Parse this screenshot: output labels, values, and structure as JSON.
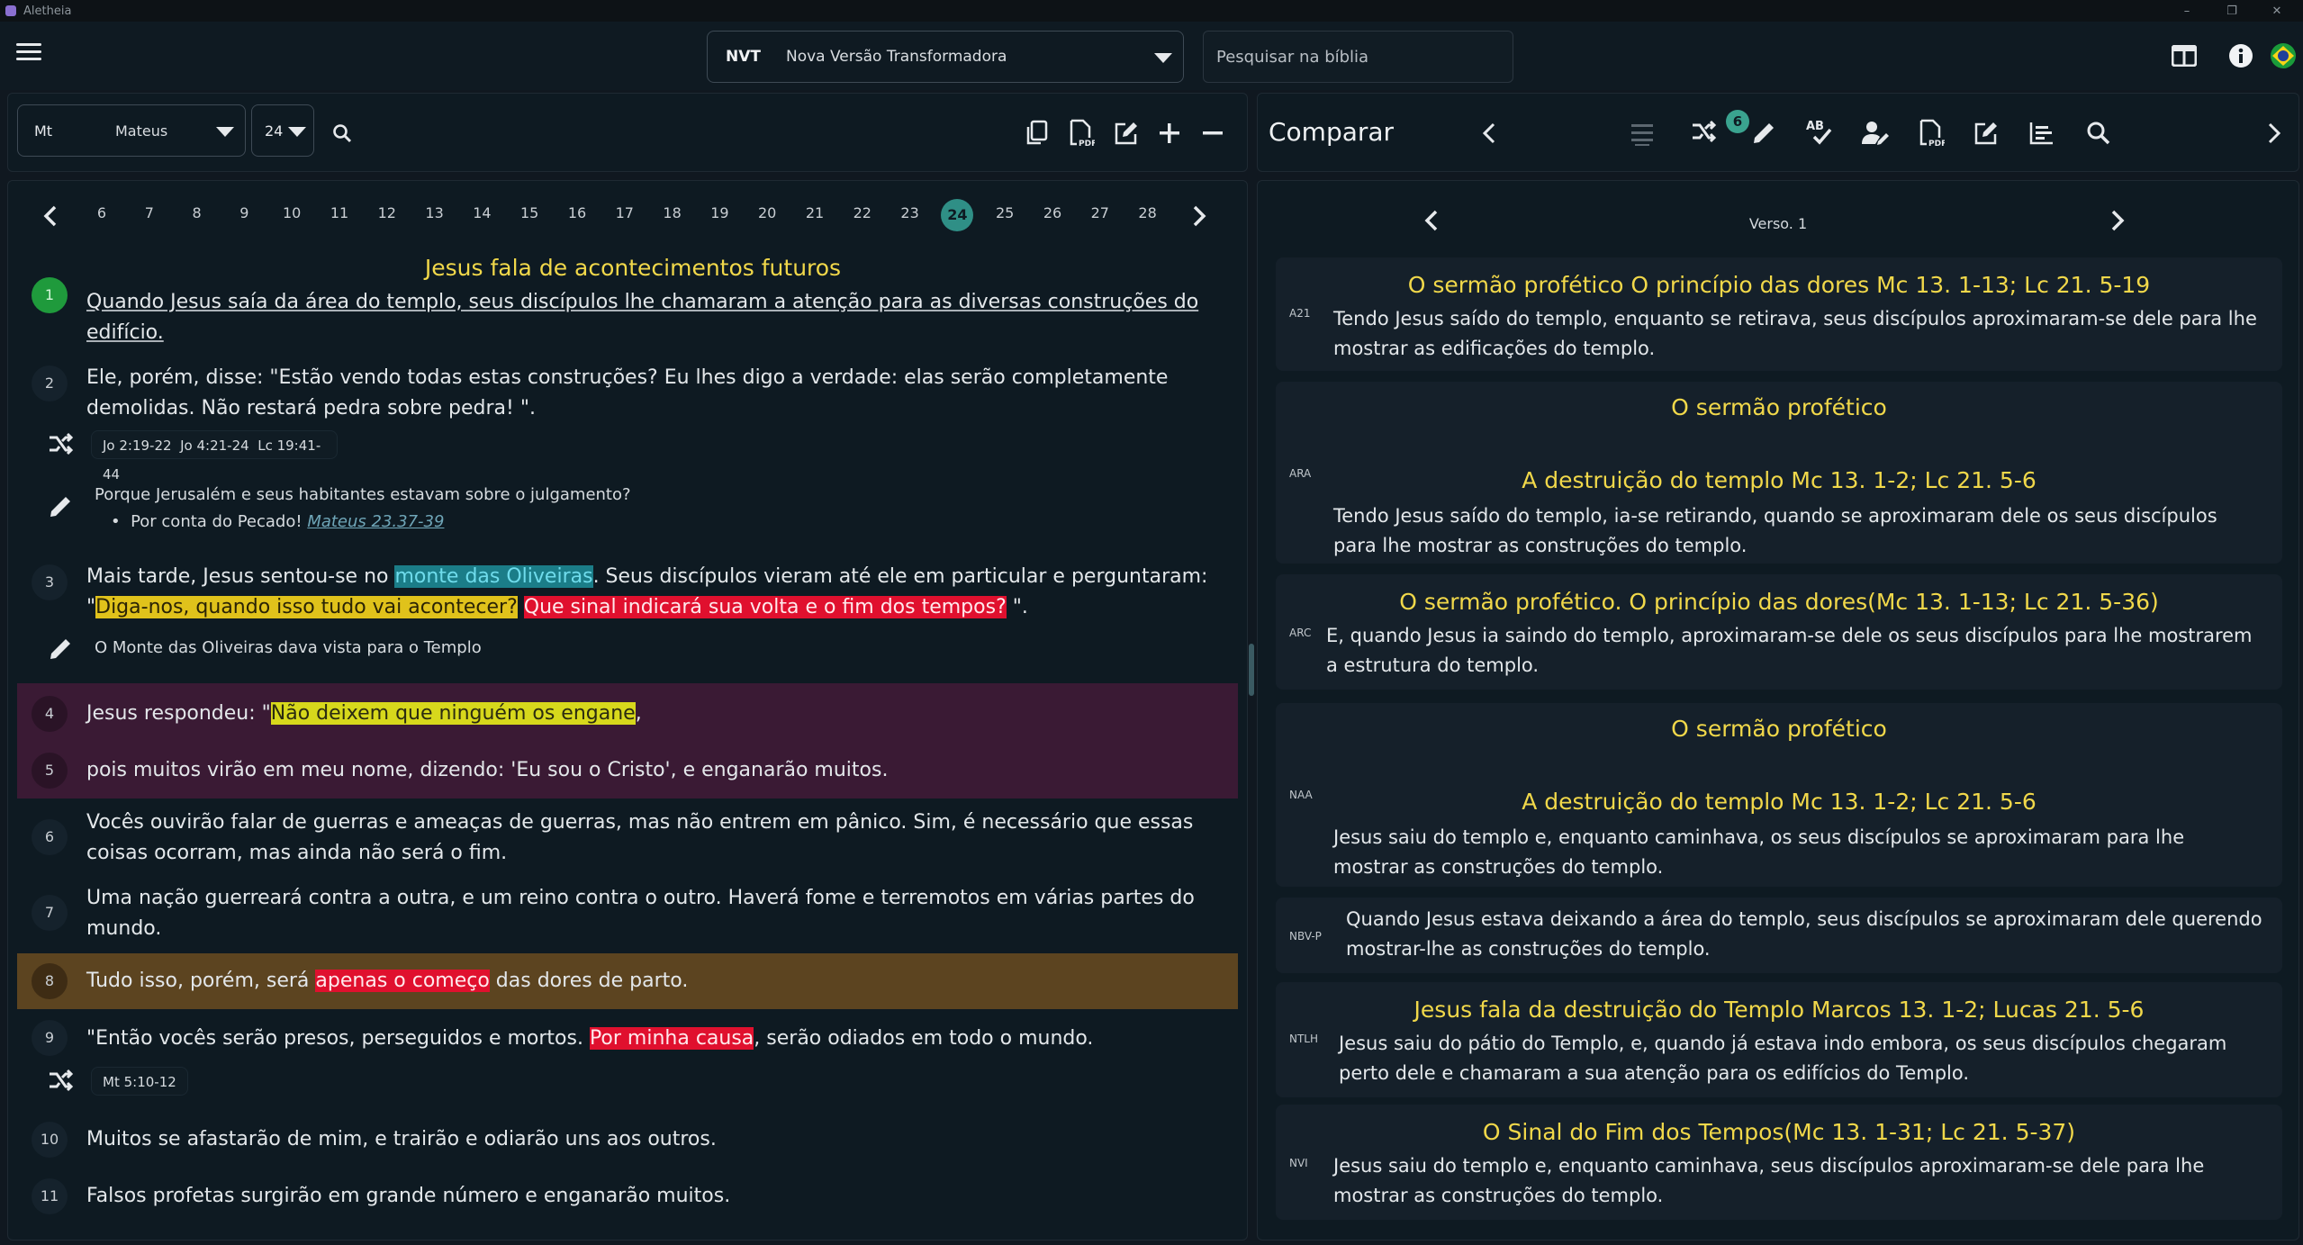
{
  "window": {
    "title": "Aletheia",
    "controls": [
      "–",
      "❐",
      "✕"
    ]
  },
  "header": {
    "version_abbr": "NVT",
    "version_name": "Nova Versão Transformadora",
    "search_placeholder": "Pesquisar na bíblia"
  },
  "reader": {
    "book_abbr": "Mt",
    "book_name": "Mateus",
    "chapter": "24",
    "chapter_nav": [
      "6",
      "7",
      "8",
      "9",
      "10",
      "11",
      "12",
      "13",
      "14",
      "15",
      "16",
      "17",
      "18",
      "19",
      "20",
      "21",
      "22",
      "23",
      "24",
      "25",
      "26",
      "27",
      "28"
    ],
    "section_title": "Jesus fala de acontecimentos futuros",
    "verses": {
      "v1": {
        "num": "1",
        "text": "Quando Jesus saía da área do templo, seus discípulos lhe chamaram a atenção para as diversas construções do edifício."
      },
      "v2": {
        "num": "2",
        "text": "Ele, porém, disse: \"Estão vendo todas estas construções? Eu lhes digo a verdade: elas serão completamente demolidas. Não restará pedra sobre pedra! \"."
      },
      "v3": {
        "num": "3",
        "t1": "Mais tarde, Jesus sentou-se no ",
        "h1": "monte das Oliveiras",
        "t2": ". Seus discípulos vieram até ele em particular e perguntaram:",
        "t3": "\"",
        "h2": "Diga-nos, quando isso tudo vai acontecer?",
        "t4": " ",
        "h3": "Que sinal indicará sua volta e o fim dos tempos?",
        "t5": " \"."
      },
      "v4": {
        "num": "4",
        "t1": "Jesus respondeu: \"",
        "h1": "Não deixem que ninguém os engane",
        "t2": ","
      },
      "v5": {
        "num": "5",
        "text": "pois muitos virão em meu nome, dizendo: 'Eu sou o Cristo', e enganarão muitos."
      },
      "v6": {
        "num": "6",
        "text": "Vocês ouvirão falar de guerras e ameaças de guerras, mas não entrem em pânico. Sim, é necessário que essas coisas ocorram, mas ainda não será o fim."
      },
      "v7": {
        "num": "7",
        "text": "Uma nação guerreará contra a outra, e um reino contra o outro. Haverá fome e terremotos em várias partes do mundo."
      },
      "v8": {
        "num": "8",
        "t1": "Tudo isso, porém, será ",
        "h1": "apenas o começo",
        "t2": " das dores de parto."
      },
      "v9": {
        "num": "9",
        "t1": "\"Então vocês serão presos, perseguidos e mortos. ",
        "h1": "Por minha causa",
        "t2": ", serão odiados em todo o mundo."
      },
      "v10": {
        "num": "10",
        "text": "Muitos se afastarão de mim, e trairão e odiarão uns aos outros."
      },
      "v11": {
        "num": "11",
        "text": "Falsos profetas surgirão em grande número e enganarão muitos."
      }
    },
    "refs_v2": [
      "Jo 2:19-22",
      "Jo 4:21-24",
      "Lc 19:41-44"
    ],
    "note_v2": {
      "question": "Porque Jerusalém e seus habitantes estavam sobre o julgamento?",
      "bullet": "Por conta do Pecado!",
      "link": "Mateus 23.37-39"
    },
    "note_v3": "O Monte das Oliveiras dava vista para o Templo",
    "refs_v9": [
      "Mt 5:10-12"
    ]
  },
  "compare": {
    "title": "Comparar",
    "badge_count": "6",
    "verse_label": "Verso. 1",
    "cards": [
      {
        "abbr": "A21",
        "title": "O sermão profético O princípio das dores  Mc 13. 1-13; Lc 21. 5-19",
        "text": "Tendo Jesus saído do templo, enquanto se retirava, seus discípulos aproximaram-se dele para lhe mostrar as edificações do templo."
      },
      {
        "abbr": "ARA",
        "title": "O sermão profético",
        "subtitle": "A destruição do templo  Mc 13. 1-2; Lc 21. 5-6",
        "text": "Tendo Jesus saído do templo, ia-se retirando, quando se aproximaram dele os seus discípulos para lhe mostrar as construções do templo."
      },
      {
        "abbr": "ARC",
        "title": "O sermão profético. O princípio das dores(Mc 13. 1-13; Lc 21. 5-36)",
        "text": "E, quando Jesus ia saindo do templo, aproximaram-se dele os seus discípulos para lhe mostrarem a estrutura do templo."
      },
      {
        "abbr": "NAA",
        "title": "O sermão profético",
        "subtitle": "A destruição do templo  Mc 13. 1-2; Lc 21. 5-6",
        "text": "Jesus saiu do templo e, enquanto caminhava, os seus discípulos se aproximaram para lhe mostrar as construções do templo."
      },
      {
        "abbr": "NBV-P",
        "text": "Quando Jesus estava deixando a área do templo, seus discípulos se aproximaram dele querendo mostrar-lhe as construções do templo."
      },
      {
        "abbr": "NTLH",
        "title": "Jesus fala da destruição do Templo  Marcos 13. 1-2; Lucas 21. 5-6",
        "text": "Jesus saiu do pátio do Templo, e, quando já estava indo embora, os seus discípulos chegaram perto dele e chamaram a sua atenção para os edifícios do Templo."
      },
      {
        "abbr": "NVI",
        "title": "O Sinal do Fim dos Tempos(Mc 13. 1-31; Lc 21. 5-37)",
        "text": "Jesus saiu do templo e, enquanto caminhava, seus discípulos aproximaram-se dele para lhe mostrar as construções do templo."
      }
    ]
  },
  "colors": {
    "background": "#101820",
    "panel": "#0e1a22",
    "title_yellow": "#f1d84a",
    "active_chapter": "#2f8f86",
    "verse1_badge": "#1f9a3c",
    "highlight_teal": "#1b7d88",
    "highlight_yellow": "#d7d81c",
    "highlight_red": "#e0102e",
    "band_purple": "#3a1a34",
    "band_gold": "#5c4420"
  }
}
